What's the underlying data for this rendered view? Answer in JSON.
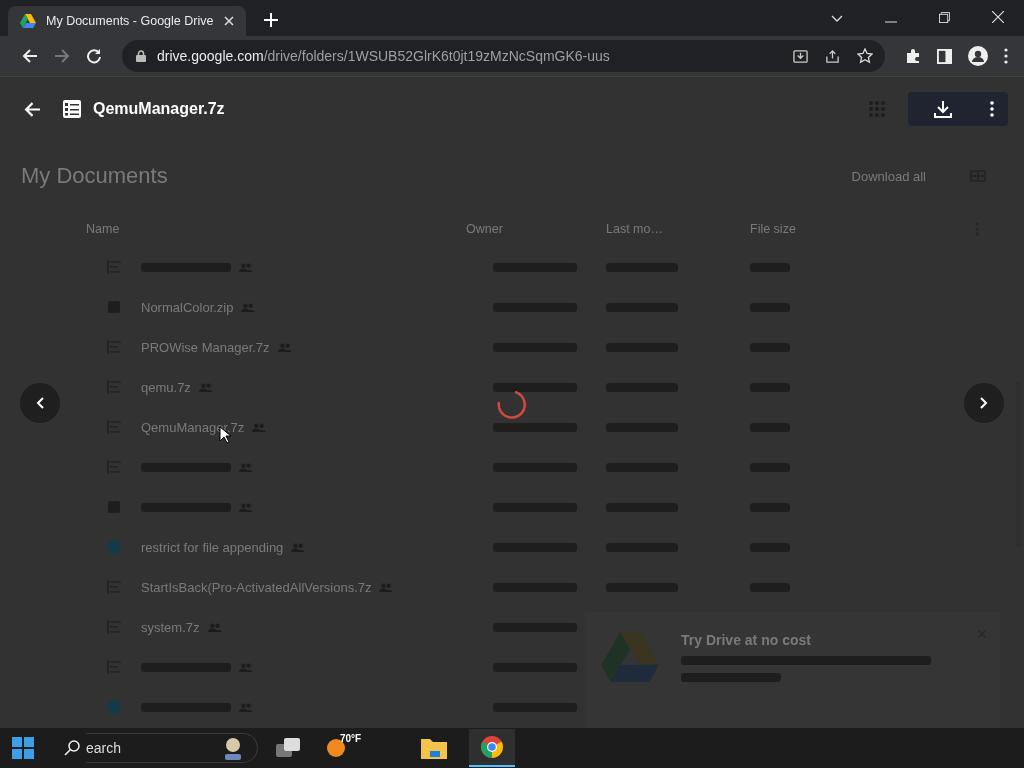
{
  "browser": {
    "tab": {
      "title": "My Documents - Google Drive"
    },
    "url": {
      "host": "drive.google.com",
      "path": "/drive/folders/1WSUB52GlrK6t0jt19zMzNcSqmGK6-uus"
    }
  },
  "viewer": {
    "file_name": "QemuManager.7z"
  },
  "page": {
    "title": "My Documents",
    "download_all": "Download all",
    "columns": [
      "Name",
      "Owner",
      "Last mo…",
      "File size"
    ],
    "rows": [
      {
        "kind": "archive"
      },
      {
        "kind": "zip",
        "name": "NormalColor.zip"
      },
      {
        "kind": "archive",
        "name": "PROWise Manager.7z"
      },
      {
        "kind": "archive",
        "name": "qemu.7z"
      },
      {
        "kind": "archive",
        "name": "QemuManager.7z"
      },
      {
        "kind": "archive"
      },
      {
        "kind": "zip"
      },
      {
        "kind": "image",
        "name": "restrict for file appending"
      },
      {
        "kind": "archive",
        "name": "StartIsBack(Pro-ActivatedAllVersions.7z"
      },
      {
        "kind": "archive",
        "name": "system.7z"
      },
      {
        "kind": "archive"
      },
      {
        "kind": "image"
      }
    ]
  },
  "promo": {
    "title": "Try Drive at no cost"
  },
  "taskbar": {
    "search": "earch",
    "weather": "70°F"
  }
}
